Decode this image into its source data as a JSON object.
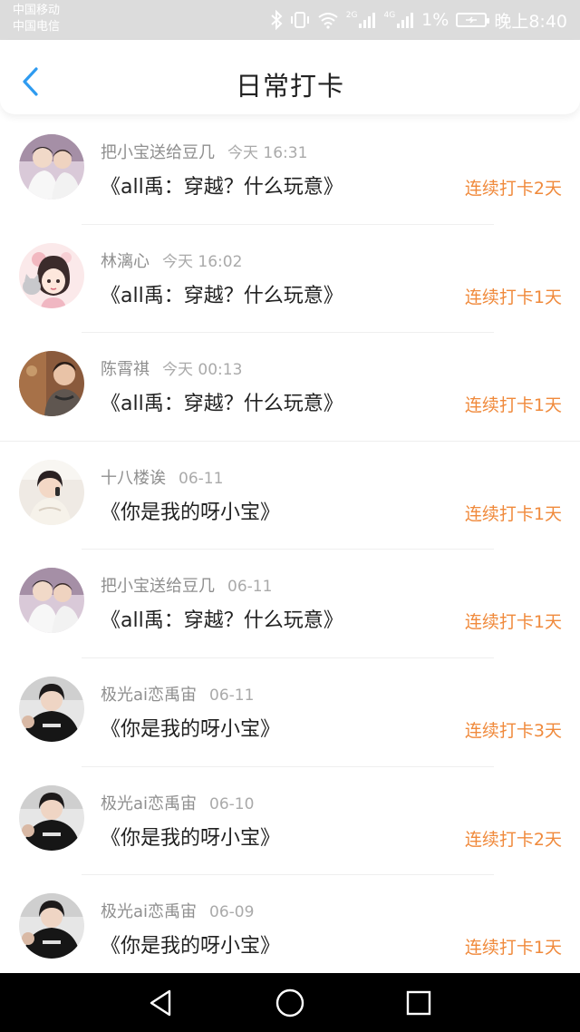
{
  "status_bar": {
    "carrier_1": "中国移动",
    "carrier_2": "中国电信",
    "signal_1_label": "2G",
    "signal_2_label": "4G",
    "battery": "1%",
    "time": "晚上8:40",
    "icons": [
      "bluetooth-icon",
      "vibrate-icon",
      "wifi-icon",
      "signal-icon",
      "signal-icon",
      "battery-icon"
    ]
  },
  "header": {
    "title": "日常打卡",
    "back_icon": "chevron-left-icon",
    "accent_color": "#2e9bf0"
  },
  "items": [
    {
      "user": "把小宝送给豆几",
      "time": "今天 16:31",
      "work": "《all禹：穿越？什么玩意》",
      "streak": "连续打卡2天",
      "avatar_style": "duo-photo"
    },
    {
      "user": "林漓心",
      "time": "今天 16:02",
      "work": "《all禹：穿越？什么玩意》",
      "streak": "连续打卡1天",
      "avatar_style": "cartoon"
    },
    {
      "user": "陈霄祺",
      "time": "今天 00:13",
      "work": "《all禹：穿越？什么玩意》",
      "streak": "连续打卡1天",
      "avatar_style": "warm-photo"
    },
    {
      "user": "十八楼诶",
      "time": "06-11",
      "work": "《你是我的呀小宝》",
      "streak": "连续打卡1天",
      "avatar_style": "light-photo"
    },
    {
      "user": "把小宝送给豆几",
      "time": "06-11",
      "work": "《all禹：穿越？什么玩意》",
      "streak": "连续打卡1天",
      "avatar_style": "duo-photo"
    },
    {
      "user": "极光ai恋禹宙",
      "time": "06-11",
      "work": "《你是我的呀小宝》",
      "streak": "连续打卡3天",
      "avatar_style": "dark-photo"
    },
    {
      "user": "极光ai恋禹宙",
      "time": "06-10",
      "work": "《你是我的呀小宝》",
      "streak": "连续打卡2天",
      "avatar_style": "dark-photo"
    },
    {
      "user": "极光ai恋禹宙",
      "time": "06-09",
      "work": "《你是我的呀小宝》",
      "streak": "连续打卡1天",
      "avatar_style": "dark-photo"
    }
  ],
  "colors": {
    "streak": "#f08a3c",
    "username": "#8f8f8f",
    "title_text": "#222222",
    "status_bar_bg": "#dcdcdc",
    "system_nav_bg": "#000000"
  },
  "system_nav": {
    "icons": [
      "back-triangle-icon",
      "home-circle-icon",
      "recents-square-icon"
    ]
  }
}
